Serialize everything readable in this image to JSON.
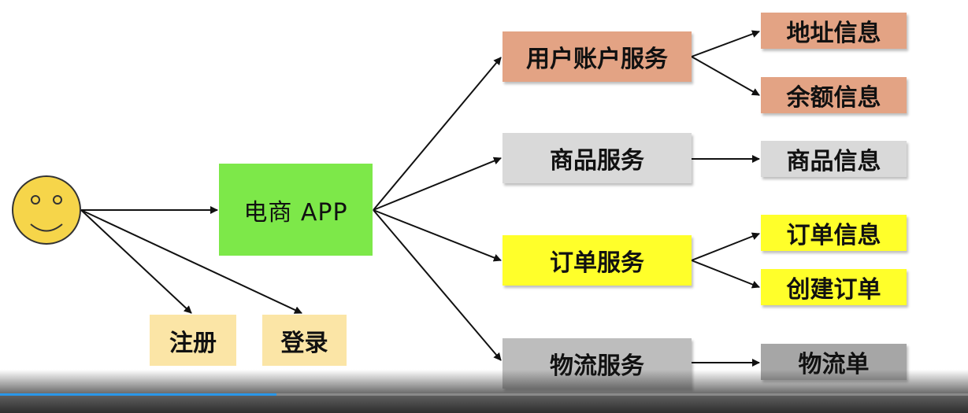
{
  "diagram": {
    "app": {
      "label": "电商 APP",
      "color": "#7de849"
    },
    "user_actions": [
      {
        "label": "注册",
        "color": "#fbe5a6"
      },
      {
        "label": "登录",
        "color": "#fbe5a6"
      }
    ],
    "services": {
      "account": {
        "label": "用户账户服务",
        "color": "#e3a384"
      },
      "goods": {
        "label": "商品服务",
        "color": "#d9d9d9"
      },
      "order": {
        "label": "订单服务",
        "color": "#ffff2a"
      },
      "logistics": {
        "label": "物流服务",
        "color": "#bdbdbd"
      }
    },
    "details": {
      "address": {
        "label": "地址信息",
        "color": "#e3a384"
      },
      "balance": {
        "label": "余额信息",
        "color": "#e3a384"
      },
      "goods_info": {
        "label": "商品信息",
        "color": "#d9d9d9"
      },
      "order_info": {
        "label": "订单信息",
        "color": "#ffff2a"
      },
      "create": {
        "label": "创建订单",
        "color": "#ffff2a"
      },
      "waybill": {
        "label": "物流单",
        "color": "#a6a6a6"
      }
    },
    "smiley_color": "#f6d54a",
    "arrow_color": "#111111"
  },
  "player": {
    "progress": 0.286,
    "accent_color": "#2a97e8"
  }
}
